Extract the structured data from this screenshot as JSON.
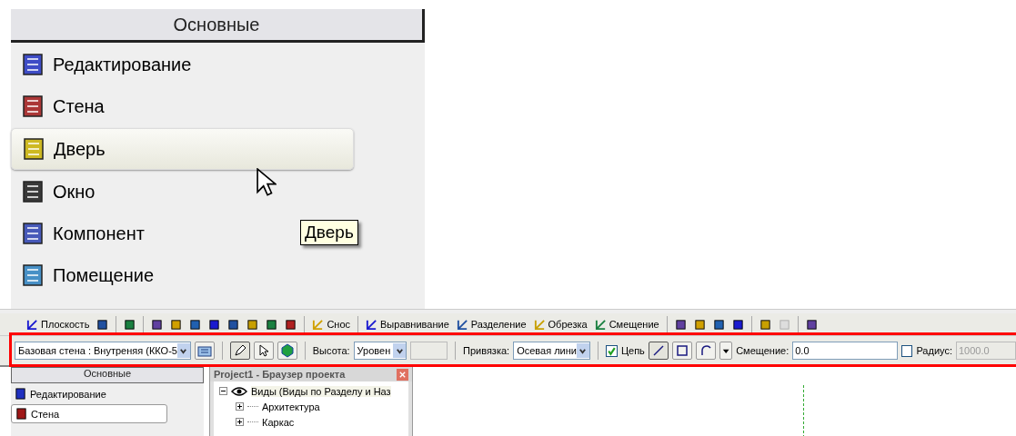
{
  "zoom_palette": {
    "title": "Основные",
    "items": [
      {
        "label": "Редактирование",
        "selected": false
      },
      {
        "label": "Стена",
        "selected": false
      },
      {
        "label": "Дверь",
        "selected": true
      },
      {
        "label": "Окно",
        "selected": false
      },
      {
        "label": "Компонент",
        "selected": false
      },
      {
        "label": "Помещение",
        "selected": false
      }
    ],
    "tooltip": "Дверь"
  },
  "toolbar": {
    "items": [
      {
        "kind": "tool",
        "label": "Плоскость"
      },
      {
        "kind": "icon"
      },
      {
        "kind": "separator"
      },
      {
        "kind": "icon"
      },
      {
        "kind": "separator"
      },
      {
        "kind": "icon"
      },
      {
        "kind": "icon"
      },
      {
        "kind": "icon"
      },
      {
        "kind": "icon"
      },
      {
        "kind": "icon"
      },
      {
        "kind": "icon"
      },
      {
        "kind": "icon"
      },
      {
        "kind": "icon"
      },
      {
        "kind": "separator"
      },
      {
        "kind": "tool",
        "label": "Снос"
      },
      {
        "kind": "separator"
      },
      {
        "kind": "tool",
        "label": "Выравнивание"
      },
      {
        "kind": "tool",
        "label": "Разделение"
      },
      {
        "kind": "tool",
        "label": "Обрезка"
      },
      {
        "kind": "tool",
        "label": "Смещение"
      },
      {
        "kind": "separator"
      },
      {
        "kind": "icon"
      },
      {
        "kind": "icon"
      },
      {
        "kind": "icon"
      },
      {
        "kind": "icon"
      },
      {
        "kind": "separator"
      },
      {
        "kind": "icon"
      },
      {
        "kind": "disabled_icon"
      },
      {
        "kind": "separator"
      },
      {
        "kind": "icon"
      }
    ]
  },
  "options_bar": {
    "type_select": "Базовая стена : Внутреняя (ККО-5",
    "height_label": "Высота:",
    "height_value": "Уровен",
    "snap_label": "Привязка:",
    "snap_value": "Осевая лини",
    "chain": {
      "label": "Цепь",
      "checked": true
    },
    "offset_label": "Смещение:",
    "offset_value": "0.0",
    "radius": {
      "label": "Радиус:",
      "checked": false
    },
    "radius_value": "1000.0"
  },
  "palette": {
    "title": "Основные",
    "items": [
      {
        "label": "Редактирование",
        "selected": false
      },
      {
        "label": "Стена",
        "selected": true
      }
    ]
  },
  "project_browser": {
    "title": "Project1 - Браузер проекта",
    "tree": [
      {
        "label": "Виды (Виды по Разделу и Наз",
        "expanded": true,
        "selected": true,
        "children": [
          {
            "label": "Архитектура",
            "expanded": false,
            "selected": false
          },
          {
            "label": "Каркас",
            "expanded": false,
            "selected": false
          }
        ]
      }
    ]
  }
}
